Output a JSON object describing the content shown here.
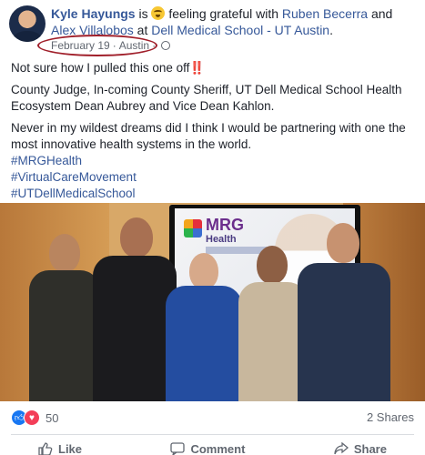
{
  "header": {
    "author": "Kyle Hayungs",
    "is_text": " is ",
    "feeling": "feeling grateful",
    "with_text": " with ",
    "tag_1": "Ruben Becerra",
    "and_text": " and ",
    "tag_2": "Alex Villalobos",
    "at_text": " at ",
    "place": "Dell Medical School - UT Austin",
    "period": "."
  },
  "meta": {
    "date": "February 19",
    "location": "Austin"
  },
  "post": {
    "line_1": "Not sure how I pulled this one off",
    "line_1_emphasis": "‼️",
    "paragraph_2": "County Judge, In-coming County Sheriff, UT Dell Medical School Health Ecosystem Dean Aubrey and Vice Dean Kahlon.",
    "paragraph_3": "Never in my wildest dreams did I think I would be partnering with one the most innovative health systems in the world.",
    "hashtags": [
      "#MRGHealth",
      "#VirtualCareMovement",
      "#UTDellMedicalSchool"
    ]
  },
  "photo": {
    "screen_logo": "MRG",
    "screen_sub": "Health"
  },
  "reactions": {
    "count": "50",
    "shares": "2 Shares"
  },
  "actions": {
    "like": "Like",
    "comment": "Comment",
    "share": "Share"
  },
  "colors": {
    "link": "#365899",
    "highlight_oval": "#a01f2a",
    "like_blue": "#1877f2",
    "love_red": "#f33e58"
  },
  "icons": [
    "globe-icon",
    "grateful-emoji-icon",
    "like-reaction-icon",
    "love-reaction-icon",
    "like-icon",
    "comment-icon",
    "share-icon"
  ]
}
